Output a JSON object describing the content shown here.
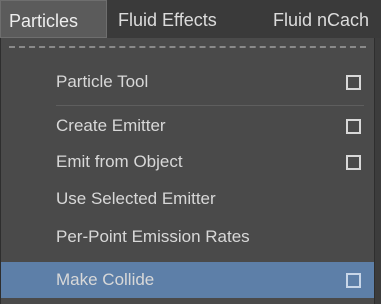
{
  "menubar": {
    "items": [
      {
        "label": "Particles"
      },
      {
        "label": "Fluid Effects"
      },
      {
        "label": "Fluid nCach"
      }
    ]
  },
  "menu": {
    "items": [
      {
        "label": "Particle Tool",
        "has_option_box": true
      },
      {
        "label": "Create Emitter",
        "has_option_box": true
      },
      {
        "label": "Emit from Object",
        "has_option_box": true
      },
      {
        "label": "Use Selected Emitter",
        "has_option_box": false
      },
      {
        "label": "Per-Point Emission Rates",
        "has_option_box": false
      },
      {
        "label": "Make Collide",
        "has_option_box": true,
        "highlighted": true
      }
    ]
  },
  "colors": {
    "highlight": "#5d7fa8",
    "menu_bg": "#4a4a4a",
    "text": "#d8d8d8"
  }
}
